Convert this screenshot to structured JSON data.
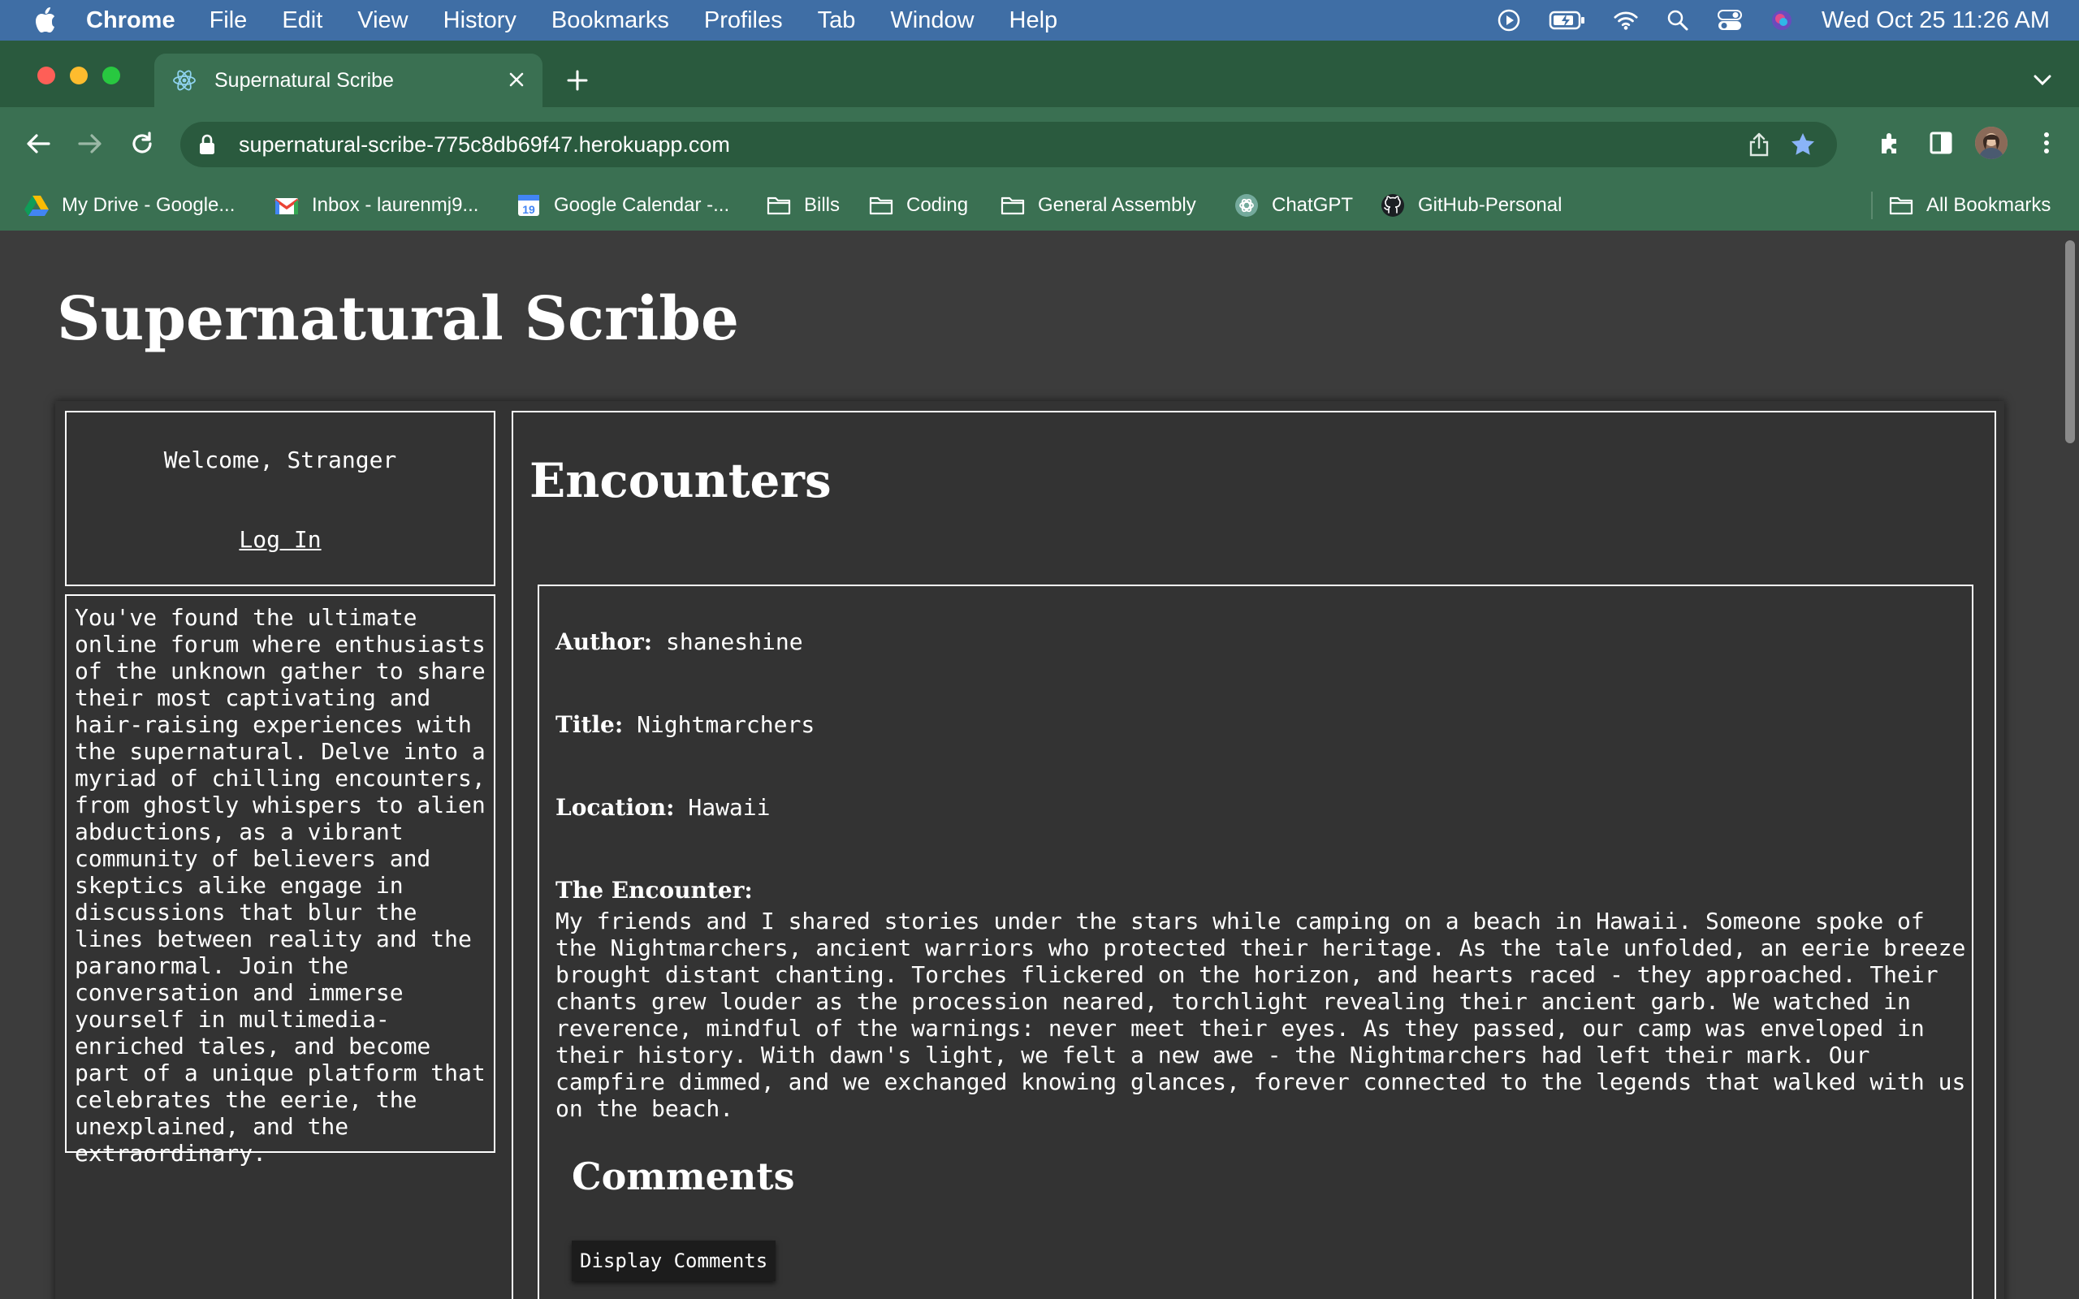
{
  "menubar": {
    "app": "Chrome",
    "items": [
      "File",
      "Edit",
      "View",
      "History",
      "Bookmarks",
      "Profiles",
      "Tab",
      "Window",
      "Help"
    ],
    "clock": "Wed Oct 25  11:26 AM"
  },
  "tab": {
    "title": "Supernatural Scribe"
  },
  "address": {
    "url": "supernatural-scribe-775c8db69f47.herokuapp.com"
  },
  "bookmarks": [
    {
      "label": "My Drive - Google...",
      "icon": "google-drive-icon"
    },
    {
      "label": "Inbox - laurenmj9...",
      "icon": "gmail-icon"
    },
    {
      "label": "Google Calendar -...",
      "icon": "calendar-icon"
    },
    {
      "label": "Bills",
      "icon": "folder-icon"
    },
    {
      "label": "Coding",
      "icon": "folder-icon"
    },
    {
      "label": "General Assembly",
      "icon": "folder-icon"
    },
    {
      "label": "ChatGPT",
      "icon": "chatgpt-icon"
    },
    {
      "label": "GitHub-Personal",
      "icon": "github-icon"
    },
    {
      "label": "All Bookmarks",
      "icon": "folder-icon"
    }
  ],
  "site": {
    "title": "Supernatural Scribe"
  },
  "sidebar": {
    "greeting": "Welcome, Stranger",
    "login": "Log In",
    "about": "You've found the ultimate online forum where enthusiasts of the unknown gather to share their most captivating and hair-raising experiences with the supernatural. Delve into a myriad of chilling encounters, from ghostly whispers to alien abductions, as a vibrant community of believers and skeptics alike engage in discussions that blur the lines between reality and the paranormal. Join the conversation and immerse yourself in multimedia-enriched tales, and become part of a unique platform that celebrates the eerie, the unexplained, and the extraordinary."
  },
  "main": {
    "heading": "Encounters",
    "encounter": {
      "author_label": "Author:",
      "author": "shaneshine",
      "title_label": "Title:",
      "title": "Nightmarchers",
      "location_label": "Location:",
      "location": "Hawaii",
      "story_label": "The Encounter:",
      "story": "My friends and I shared stories under the stars while camping on a beach in Hawaii. Someone spoke of the Nightmarchers, ancient warriors who protected their heritage. As the tale unfolded, an eerie breeze brought distant chanting. Torches flickered on the horizon, and hearts raced - they approached. Their chants grew louder as the procession neared, torchlight revealing their ancient garb. We watched in reverence, mindful of the warnings: never meet their eyes. As they passed, our camp was enveloped in their history. With dawn's light, we felt a new awe - the Nightmarchers had left their mark. Our campfire dimmed, and we exchanged knowing glances, forever connected to the legends that walked with us on the beach."
    },
    "comments_heading": "Comments",
    "display_comments": "Display Comments"
  }
}
